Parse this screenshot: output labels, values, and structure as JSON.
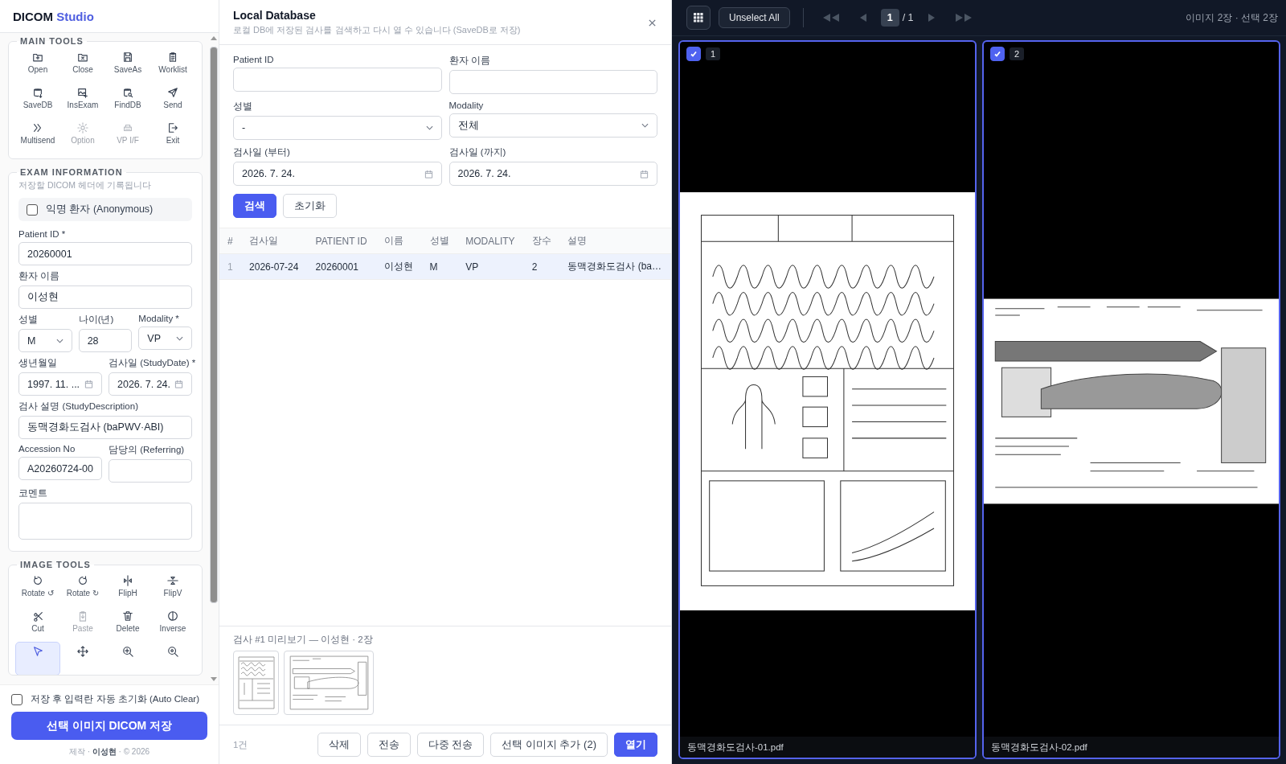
{
  "app": {
    "name": "DICOM",
    "accent": "Studio"
  },
  "main_tools": {
    "title": "MAIN TOOLS",
    "items": [
      {
        "label": "Open",
        "disabled": false
      },
      {
        "label": "Close",
        "disabled": false
      },
      {
        "label": "SaveAs",
        "disabled": false
      },
      {
        "label": "Worklist",
        "disabled": false
      },
      {
        "label": "SaveDB",
        "disabled": false
      },
      {
        "label": "InsExam",
        "disabled": false
      },
      {
        "label": "FindDB",
        "disabled": false
      },
      {
        "label": "Send",
        "disabled": false
      },
      {
        "label": "Multisend",
        "disabled": false
      },
      {
        "label": "Option",
        "disabled": true
      },
      {
        "label": "VP I/F",
        "disabled": true
      },
      {
        "label": "Exit",
        "disabled": false
      }
    ]
  },
  "exam_info": {
    "title": "EXAM INFORMATION",
    "subtitle": "저장할 DICOM 헤더에 기록됩니다",
    "anonymous": {
      "label": "익명 환자 (Anonymous)",
      "checked": false
    },
    "rows": [
      [
        {
          "label": "Patient ID *",
          "value": "20260001",
          "kind": "text"
        }
      ],
      [
        {
          "label": "환자 이름",
          "value": "이성현",
          "kind": "text"
        }
      ],
      [
        {
          "label": "성별",
          "value": "M",
          "kind": "select"
        },
        {
          "label": "나이(년)",
          "value": "28",
          "kind": "text"
        },
        {
          "label": "Modality *",
          "value": "VP",
          "kind": "select"
        }
      ],
      [
        {
          "label": "생년월일",
          "value": "1997. 11. ...",
          "kind": "date"
        },
        {
          "label": "검사일 (StudyDate) *",
          "value": "2026. 7. 24.",
          "kind": "date"
        }
      ],
      [
        {
          "label": "검사 설명 (StudyDescription)",
          "value": "동맥경화도검사 (baPWV·ABI)",
          "kind": "text"
        }
      ],
      [
        {
          "label": "Accession No",
          "value": "A20260724-00",
          "kind": "text"
        },
        {
          "label": "담당의 (Referring)",
          "kind": "text"
        }
      ],
      [
        {
          "label": "코멘트",
          "kind": "textarea"
        }
      ]
    ]
  },
  "image_tools": {
    "title": "IMAGE TOOLS",
    "items": [
      {
        "label": "Rotate ↺",
        "disabled": false,
        "selected": false
      },
      {
        "label": "Rotate ↻",
        "disabled": false,
        "selected": false
      },
      {
        "label": "FlipH",
        "disabled": false,
        "selected": false
      },
      {
        "label": "FlipV",
        "disabled": false,
        "selected": false
      },
      {
        "label": "Cut",
        "disabled": false,
        "selected": false
      },
      {
        "label": "Paste",
        "disabled": true,
        "selected": false
      },
      {
        "label": "Delete",
        "disabled": false,
        "selected": false
      },
      {
        "label": "Inverse",
        "disabled": false,
        "selected": false
      },
      {
        "disabled": false,
        "selected": true
      },
      {
        "disabled": false,
        "selected": false
      },
      {
        "disabled": false,
        "selected": false
      },
      {
        "disabled": false,
        "selected": false
      }
    ]
  },
  "auto_clear": {
    "label": "저장 후 입력란 자동 초기화 (Auto Clear)",
    "checked": false
  },
  "save_button": "선택 이미지 DICOM 저장",
  "credit": "제작 · **이성현** · © 2026",
  "dialog": {
    "title": "Local Database",
    "subtitle": "로컬 DB에 저장된 검사를 검색하고 다시 열 수 있습니다 (SaveDB로 저장)",
    "filters": [
      {
        "label": "Patient ID",
        "kind": "text"
      },
      {
        "label": "환자 이름",
        "kind": "text"
      },
      {
        "label": "성별",
        "value": "-",
        "kind": "select"
      },
      {
        "label": "Modality",
        "value": "전체",
        "kind": "select"
      },
      {
        "label": "검사일 (부터)",
        "value": "2026. 7. 24.",
        "kind": "date"
      },
      {
        "label": "검사일 (까지)",
        "value": "2026. 7. 24.",
        "kind": "date"
      }
    ],
    "actions": [
      {
        "label": "검색",
        "kind": "primary"
      },
      {
        "label": "초기화",
        "kind": "secondary"
      }
    ],
    "table": {
      "columns": [
        "#",
        "검사일",
        "PATIENT ID",
        "이름",
        "성별",
        "MODALITY",
        "장수",
        "설명"
      ],
      "rows": [
        {
          "cells": [
            "1",
            "2026-07-24",
            "20260001",
            "이성현",
            "M",
            "VP",
            "2",
            "동맥경화도검사 (ba…"
          ],
          "selected": true
        }
      ]
    },
    "preview": {
      "label": "검사 #1 미리보기 — 이성현 · 2장",
      "thumbnails": [
        {
          "kind": "portrait"
        },
        {
          "kind": "landscape"
        }
      ]
    },
    "count": "1건",
    "buttons": [
      {
        "label": "삭제",
        "kind": "secondary"
      },
      {
        "label": "전송",
        "kind": "secondary"
      },
      {
        "label": "다중 전송",
        "kind": "secondary"
      },
      {
        "label": "선택 이미지 추가 (2)",
        "kind": "secondary"
      },
      {
        "label": "열기",
        "kind": "primary"
      }
    ]
  },
  "viewer": {
    "unselect_button": "Unselect All",
    "page": "1",
    "total": "/ 1",
    "status": "이미지 2장 · 선택 2장",
    "images": [
      {
        "index": "1",
        "checked": true,
        "selected": true,
        "kind": "portrait",
        "filename": "동맥경화도검사-01.pdf"
      },
      {
        "index": "2",
        "checked": true,
        "selected": true,
        "kind": "landscape",
        "filename": "동맥경화도검사-02.pdf"
      }
    ]
  }
}
